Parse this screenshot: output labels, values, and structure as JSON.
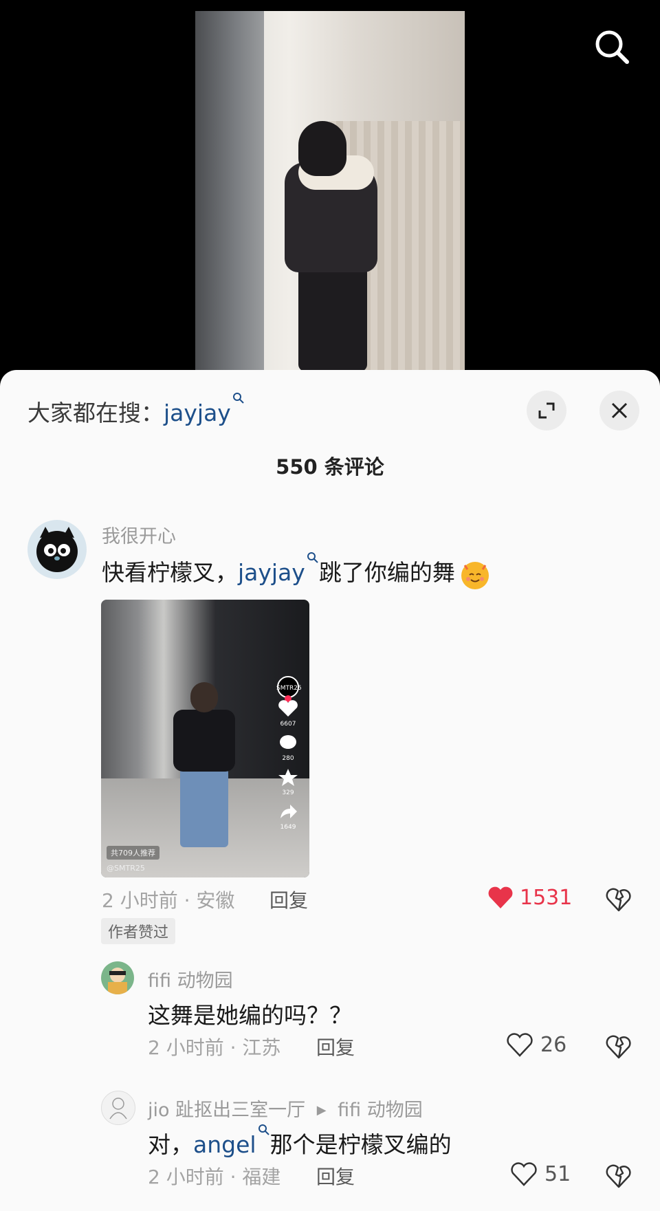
{
  "video": {
    "search_icon": "search-icon"
  },
  "panel": {
    "trend_prefix": "大家都在搜：",
    "trend_keyword": "jayjay",
    "comment_count": "550 条评论"
  },
  "comments": [
    {
      "username": "我很开心",
      "text_before": "快看柠檬叉，",
      "keyword": "jayjay",
      "text_after": "跳了你编的舞",
      "time_location": "2 小时前 · 安徽",
      "reply_label": "回复",
      "likes": "1531",
      "liked": true,
      "badge": "作者赞过",
      "thumbnail": {
        "recommend_tag": "共709人推荐",
        "handle": "@SMTR25",
        "avatar_label": "SMTR25",
        "like_count": "6607",
        "comment_count": "280",
        "fav_count": "329",
        "share_count": "1649"
      }
    }
  ],
  "replies": [
    {
      "username": "fifi 动物园",
      "text": "这舞是她编的吗？？",
      "time_location": "2 小时前 · 江苏",
      "reply_label": "回复",
      "likes": "26"
    },
    {
      "username": "jio 趾抠出三室一厅",
      "reply_to": "fifi 动物园",
      "text_before": "对，",
      "keyword": "angel",
      "text_after": "那个是柠檬叉编的",
      "time_location": "2 小时前 · 福建",
      "reply_label": "回复",
      "likes": "51"
    }
  ],
  "colors": {
    "keyword": "#1d4f8a",
    "like_active": "#e8344a",
    "sheet_bg": "#fafafa"
  }
}
